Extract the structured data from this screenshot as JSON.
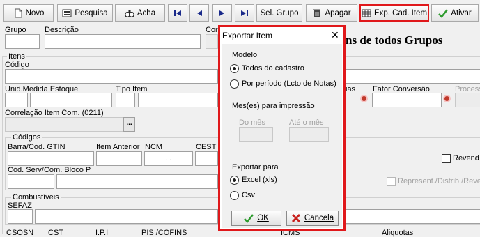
{
  "toolbar": {
    "novo": "Novo",
    "pesquisa": "Pesquisa",
    "acha": "Acha",
    "sel_grupo": "Sel. Grupo",
    "apagar": "Apagar",
    "exp_cad_item": "Exp. Cad. Item",
    "ativar": "Ativar"
  },
  "form": {
    "grupo": "Grupo",
    "descricao": "Descrição",
    "cor": "Cor",
    "heading": "ns de todos Grupos",
    "itens": "Itens",
    "codigo": "Código",
    "unid_medida": "Unid.Medida Estoque",
    "tipo_item": "Tipo Item",
    "ias": "ias",
    "fator_conversao": "Fator Conversão",
    "process": "Process",
    "correlacao": "Correlação Item Com. (0211)",
    "codigos": "Códigos",
    "barra_gtin": "Barra/Cód. GTIN",
    "item_anterior": "Item Anterior",
    "ncm": "NCM",
    "ncm_value": ". .",
    "cest": "CEST",
    "revenda": "Revend",
    "cod_serv": "Cód. Serv/Com. Bloco P",
    "represent": "Represent./Distrib./Reve",
    "combustiveis": "Combustíveis",
    "sefaz": "SEFAZ",
    "csosn": "CSOSN",
    "cst": "CST",
    "ipi": "I.P.I",
    "pis_cofins": "PIS /COFINS",
    "icms": "ICMS",
    "aliquotas": "Aliquotas",
    "dots": "..."
  },
  "dialog": {
    "title": "Exportar Item",
    "modelo": "Modelo",
    "opt_todos": "Todos do cadastro",
    "opt_periodo": "Por período (Lcto de Notas)",
    "meses_label": "Mes(es) para impressão",
    "do_mes": "Do mês",
    "ate_mes": "Até o mês",
    "exportar_para": "Exportar para",
    "opt_excel": "Excel (xls)",
    "opt_csv": "Csv",
    "ok": "OK",
    "cancela": "Cancela",
    "close": "✕"
  },
  "colors": {
    "highlight": "#e0181b"
  }
}
